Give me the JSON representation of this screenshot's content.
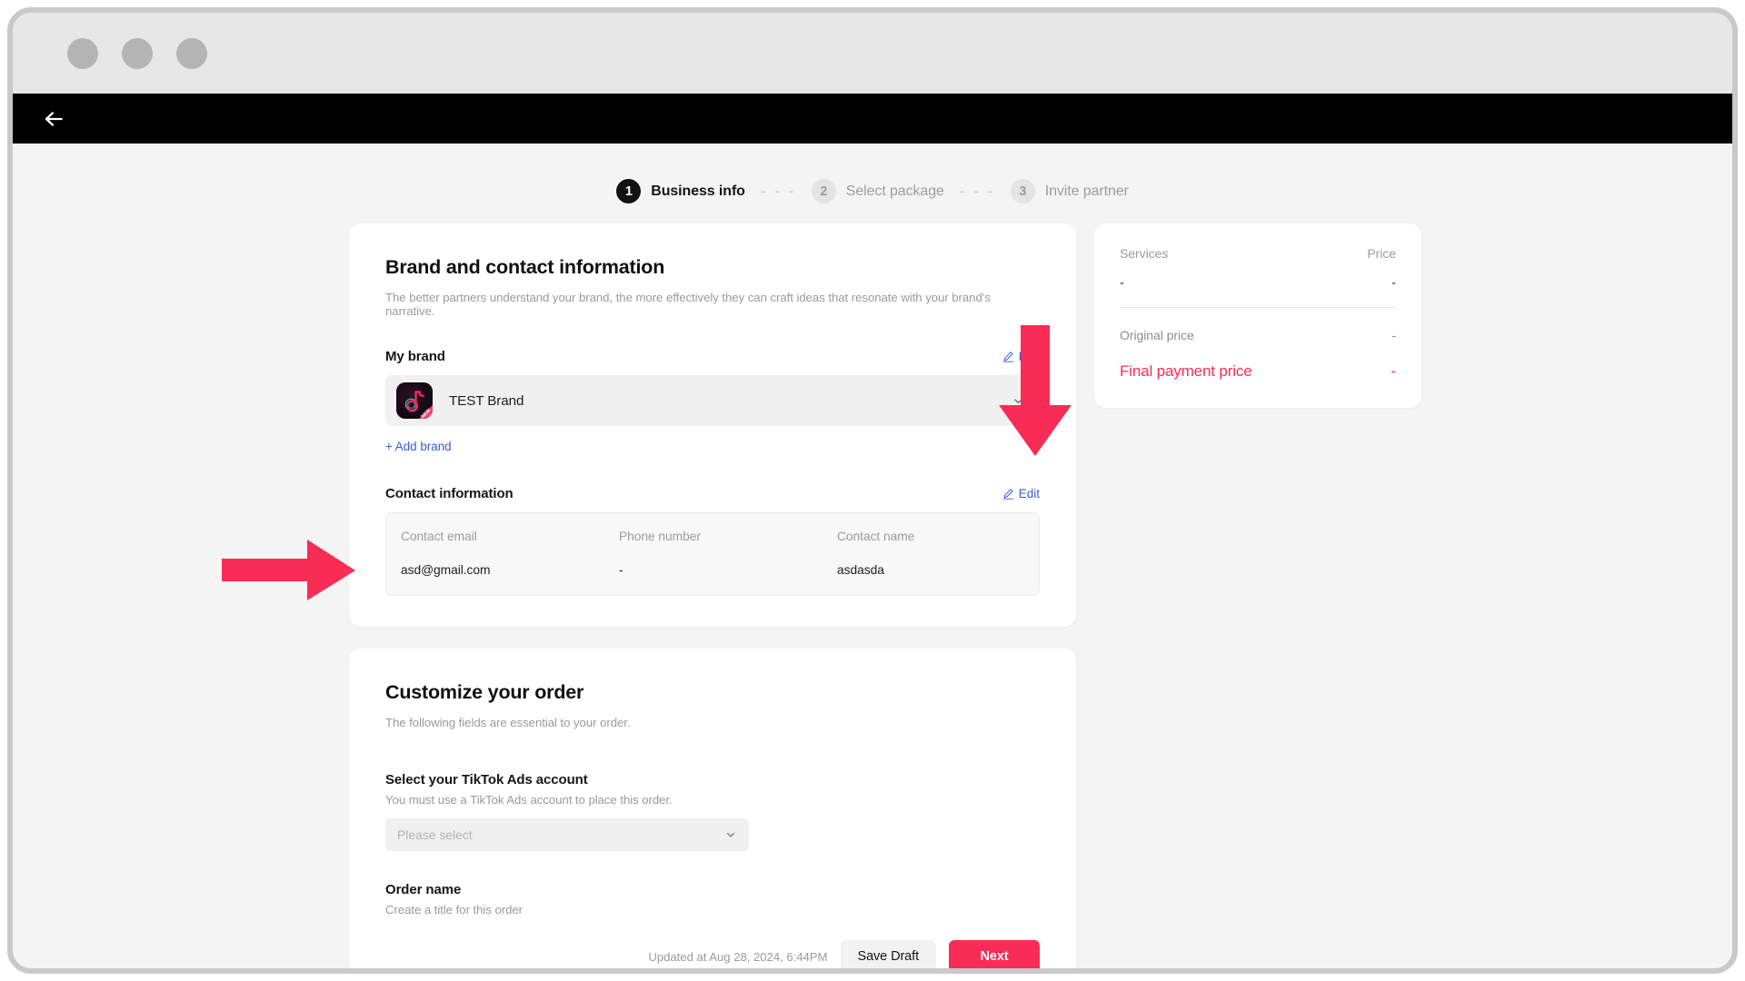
{
  "window": {
    "traffic_lights": [
      "close-dot",
      "minimize-dot",
      "maximize-dot"
    ]
  },
  "appbar": {
    "back_icon": "arrow-left-icon"
  },
  "stepper": {
    "steps": [
      {
        "number": "1",
        "label": "Business info",
        "state": "active"
      },
      {
        "number": "2",
        "label": "Select package",
        "state": "inactive"
      },
      {
        "number": "3",
        "label": "Invite partner",
        "state": "inactive"
      }
    ],
    "separator": "- - -"
  },
  "brand_card": {
    "title": "Brand and contact information",
    "subtitle": "The better partners understand your brand, the more effectively they can craft ideas that resonate with your brand's narrative.",
    "my_brand": {
      "label": "My brand",
      "edit_label": "Edit",
      "edit_icon": "pencil-icon",
      "brand_name": "TEST Brand",
      "brand_avatar_icon": "tiktok-note-icon",
      "brand_avatar_badge": "NEW",
      "expand_icon": "chevron-down-icon",
      "add_brand_label": "+ Add brand"
    },
    "contact": {
      "label": "Contact information",
      "edit_label": "Edit",
      "edit_icon": "pencil-icon",
      "columns": [
        {
          "header": "Contact email",
          "value": "asd@gmail.com"
        },
        {
          "header": "Phone number",
          "value": "-"
        },
        {
          "header": "Contact name",
          "value": "asdasda"
        }
      ]
    }
  },
  "order_card": {
    "title": "Customize your order",
    "subtitle": "The following fields are essential to your order.",
    "ads_account": {
      "label": "Select your TikTok Ads account",
      "help": "You must use a TikTok Ads account to place this order.",
      "placeholder": "Please select",
      "chevron_icon": "chevron-down-icon"
    },
    "order_name": {
      "label": "Order name",
      "help": "Create a title for this order"
    },
    "footer": {
      "updated_text": "Updated at Aug 28, 2024, 6:44PM",
      "save_draft_label": "Save Draft",
      "next_label": "Next"
    }
  },
  "summary": {
    "services_header": "Services",
    "price_header": "Price",
    "services_value": "-",
    "price_value": "-",
    "original_price_label": "Original price",
    "original_price_value": "-",
    "final_price_label": "Final payment price",
    "final_price_value": "-"
  },
  "annotations": [
    {
      "name": "arrow-down-to-edit",
      "icon": "arrow-down-annotation"
    },
    {
      "name": "arrow-right-to-add-brand",
      "icon": "arrow-right-annotation"
    }
  ],
  "colors": {
    "accent_pink": "#f92c55",
    "link_blue": "#3a5bd9",
    "appbar_black": "#000000",
    "page_bg": "#f4f4f4"
  }
}
